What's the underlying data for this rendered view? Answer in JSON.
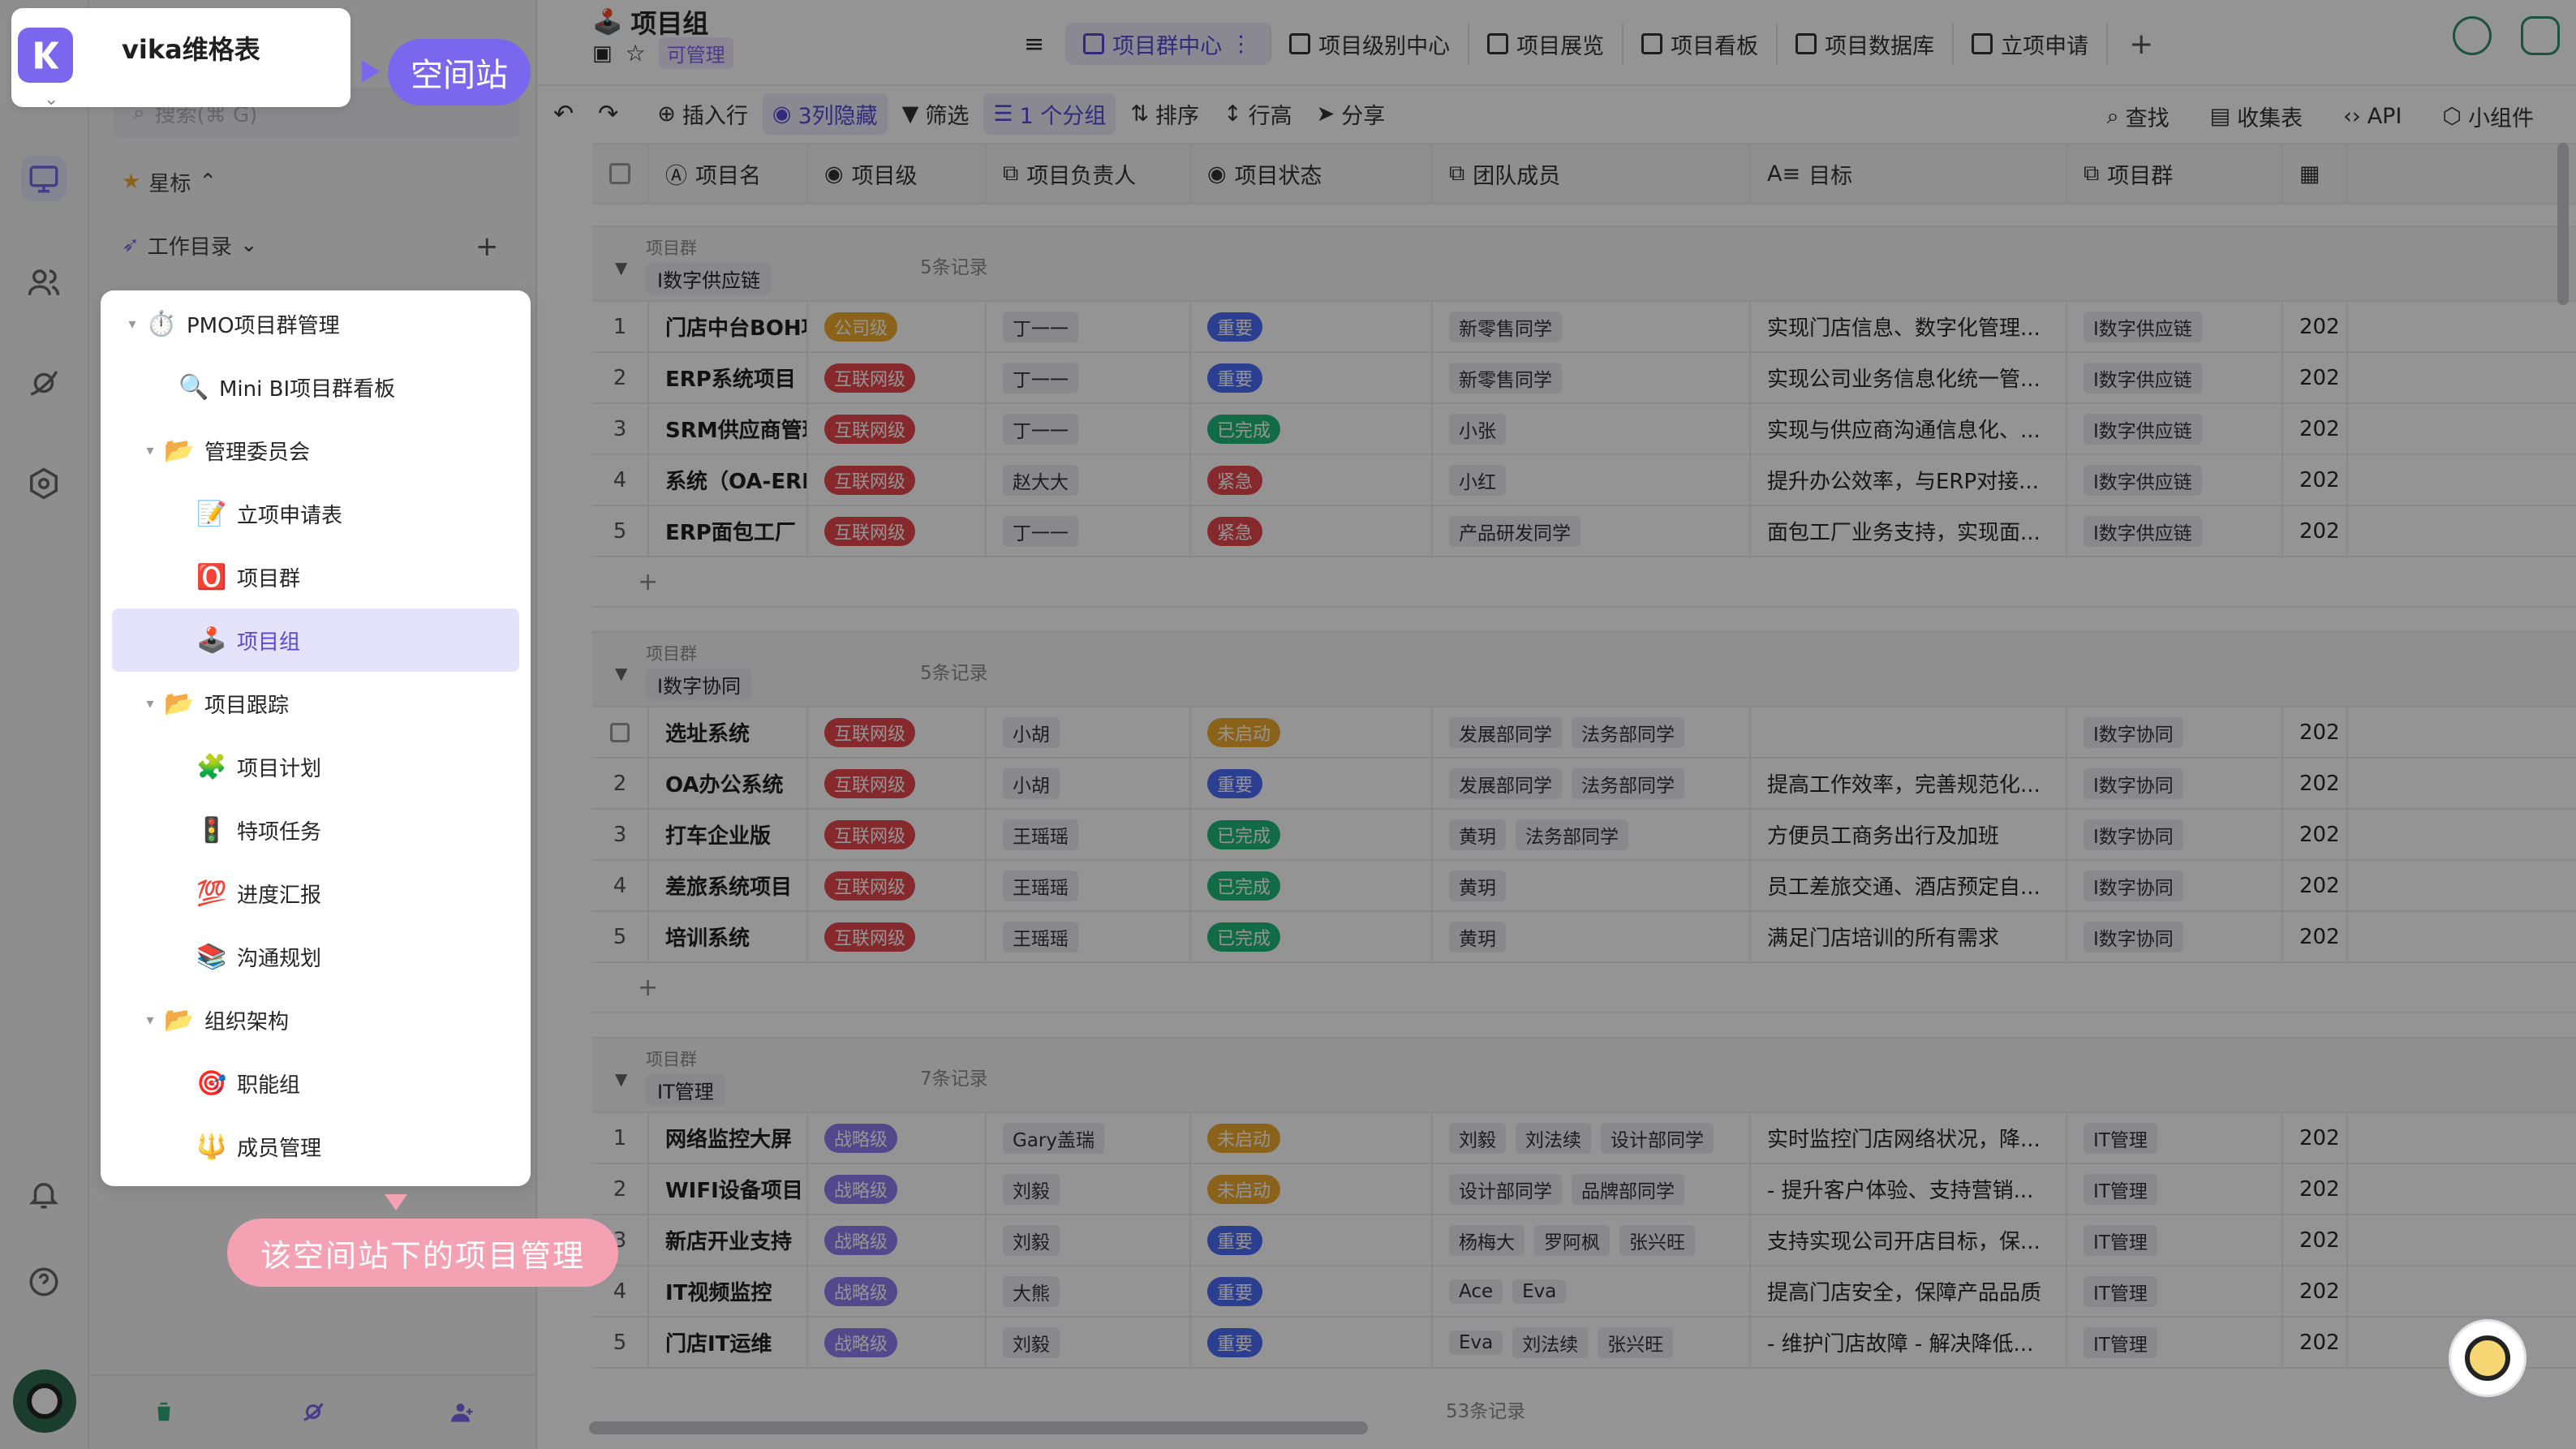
{
  "brand": {
    "name": "vika维格表"
  },
  "callouts": {
    "space": "空间站",
    "project": "该空间站下的项目管理"
  },
  "sidebar": {
    "search_placeholder": "搜索(⌘ G)",
    "starred": "星标",
    "catalog": "工作目录",
    "tree": [
      {
        "label": "PMO项目群管理",
        "level": 0,
        "caret": "▾",
        "icon": "⏱️",
        "icon_name": "stopwatch-icon"
      },
      {
        "label": "Mini BI项目群看板",
        "level": 1,
        "caret": "",
        "icon": "🔍",
        "icon_name": "magnifier-icon"
      },
      {
        "label": "管理委员会",
        "level": 1,
        "caret": "▾",
        "icon": "📂",
        "icon_name": "folder-icon"
      },
      {
        "label": "立项申请表",
        "level": 2,
        "caret": "",
        "icon": "📝",
        "icon_name": "memo-icon"
      },
      {
        "label": "项目群",
        "level": 2,
        "caret": "",
        "icon": "🅾️",
        "icon_name": "o-button-icon"
      },
      {
        "label": "项目组",
        "level": 2,
        "caret": "",
        "icon": "🕹️",
        "icon_name": "joystick-icon",
        "selected": true
      },
      {
        "label": "项目跟踪",
        "level": 1,
        "caret": "▾",
        "icon": "📂",
        "icon_name": "folder-icon"
      },
      {
        "label": "项目计划",
        "level": 2,
        "caret": "",
        "icon": "🧩",
        "icon_name": "puzzle-icon"
      },
      {
        "label": "特项任务",
        "level": 2,
        "caret": "",
        "icon": "🚦",
        "icon_name": "traffic-light-icon"
      },
      {
        "label": "进度汇报",
        "level": 2,
        "caret": "",
        "icon": "💯",
        "icon_name": "hundred-icon"
      },
      {
        "label": "沟通规划",
        "level": 2,
        "caret": "",
        "icon": "📚",
        "icon_name": "books-icon"
      },
      {
        "label": "组织架构",
        "level": 1,
        "caret": "▾",
        "icon": "📂",
        "icon_name": "folder-icon"
      },
      {
        "label": "职能组",
        "level": 2,
        "caret": "",
        "icon": "🎯",
        "icon_name": "target-icon"
      },
      {
        "label": "成员管理",
        "level": 2,
        "caret": "",
        "icon": "🔱",
        "icon_name": "trident-icon"
      }
    ]
  },
  "header": {
    "title": "项目组",
    "permission": "可管理",
    "tabs": [
      {
        "label": "项目群中心",
        "active": true
      },
      {
        "label": "项目级别中心"
      },
      {
        "label": "项目展览"
      },
      {
        "label": "项目看板"
      },
      {
        "label": "项目数据库"
      },
      {
        "label": "立项申请"
      }
    ]
  },
  "toolbar": {
    "insert": "插入行",
    "hidden": "3列隐藏",
    "filter": "筛选",
    "group": "1 个分组",
    "sort": "排序",
    "row_height": "行高",
    "share": "分享",
    "find": "查找",
    "form": "收集表",
    "api": "API",
    "widget": "小组件"
  },
  "columns": [
    "项目名",
    "项目级",
    "项目负责人",
    "项目状态",
    "团队成员",
    "目标",
    "项目群"
  ],
  "colors": {
    "accent": "#7b67ee",
    "level": {
      "公司级": "#f0a92e",
      "互联网级": "#e5484d",
      "战略级": "#8e7cf0"
    },
    "status": {
      "重要": "#4a6cf7",
      "已完成": "#1fb87a",
      "紧急": "#e5484d",
      "未启动": "#f0a92e"
    }
  },
  "groups": [
    {
      "label": "项目群",
      "value": "I数字供应链",
      "count": "5条记录",
      "rows": [
        {
          "idx": "1",
          "name": "门店中台BOH项目",
          "level": "公司级",
          "owner": "丁一一",
          "status": "重要",
          "members": [
            "新零售同学"
          ],
          "goal": "实现门店信息、数字化管理...",
          "group": "I数字供应链",
          "date": "202"
        },
        {
          "idx": "2",
          "name": "ERP系统项目",
          "level": "互联网级",
          "owner": "丁一一",
          "status": "重要",
          "members": [
            "新零售同学"
          ],
          "goal": "实现公司业务信息化统一管...",
          "group": "I数字供应链",
          "date": "202"
        },
        {
          "idx": "3",
          "name": "SRM供应商管理系统项目",
          "level": "互联网级",
          "owner": "丁一一",
          "status": "已完成",
          "members": [
            "小张"
          ],
          "goal": "实现与供应商沟通信息化、...",
          "group": "I数字供应链",
          "date": "202"
        },
        {
          "idx": "4",
          "name": "系统（OA-ERP-银行）",
          "level": "互联网级",
          "owner": "赵大大",
          "status": "紧急",
          "members": [
            "小红"
          ],
          "goal": "提升办公效率，与ERP对接...",
          "group": "I数字供应链",
          "date": "202"
        },
        {
          "idx": "5",
          "name": "ERP面包工厂",
          "level": "互联网级",
          "owner": "丁一一",
          "status": "紧急",
          "members": [
            "产品研发同学"
          ],
          "goal": "面包工厂业务支持，实现面...",
          "group": "I数字供应链",
          "date": "202"
        }
      ]
    },
    {
      "label": "项目群",
      "value": "I数字协同",
      "count": "5条记录",
      "rows": [
        {
          "idx": "",
          "name": "选址系统",
          "level": "互联网级",
          "owner": "小胡",
          "status": "未启动",
          "members": [
            "发展部同学",
            "法务部同学"
          ],
          "goal": "",
          "group": "I数字协同",
          "date": "202"
        },
        {
          "idx": "2",
          "name": "OA办公系统",
          "level": "互联网级",
          "owner": "小胡",
          "status": "重要",
          "members": [
            "发展部同学",
            "法务部同学"
          ],
          "goal": "提高工作效率，完善规范化...",
          "group": "I数字协同",
          "date": "202"
        },
        {
          "idx": "3",
          "name": "打车企业版",
          "level": "互联网级",
          "owner": "王瑶瑶",
          "status": "已完成",
          "members": [
            "黄玥",
            "法务部同学"
          ],
          "goal": "方便员工商务出行及加班",
          "group": "I数字协同",
          "date": "202"
        },
        {
          "idx": "4",
          "name": "差旅系统项目",
          "level": "互联网级",
          "owner": "王瑶瑶",
          "status": "已完成",
          "members": [
            "黄玥"
          ],
          "goal": "员工差旅交通、酒店预定自...",
          "group": "I数字协同",
          "date": "202"
        },
        {
          "idx": "5",
          "name": "培训系统",
          "level": "互联网级",
          "owner": "王瑶瑶",
          "status": "已完成",
          "members": [
            "黄玥"
          ],
          "goal": "满足门店培训的所有需求",
          "group": "I数字协同",
          "date": "202"
        }
      ]
    },
    {
      "label": "项目群",
      "value": "IT管理",
      "count": "7条记录",
      "rows": [
        {
          "idx": "1",
          "name": "网络监控大屏",
          "level": "战略级",
          "owner": "Gary盖瑞",
          "status": "未启动",
          "members": [
            "刘毅",
            "刘法续",
            "设计部同学"
          ],
          "goal": "实时监控门店网络状况，降...",
          "group": "IT管理",
          "date": "202"
        },
        {
          "idx": "2",
          "name": "WIFI设备项目",
          "level": "战略级",
          "owner": "刘毅",
          "status": "未启动",
          "members": [
            "设计部同学",
            "品牌部同学"
          ],
          "goal": "- 提升客户体验、支持营销...",
          "group": "IT管理",
          "date": "202"
        },
        {
          "idx": "3",
          "name": "新店开业支持",
          "level": "战略级",
          "owner": "刘毅",
          "status": "重要",
          "members": [
            "杨梅大",
            "罗阿枫",
            "张兴旺"
          ],
          "goal": "支持实现公司开店目标，保...",
          "group": "IT管理",
          "date": "202"
        },
        {
          "idx": "4",
          "name": "IT视频监控",
          "level": "战略级",
          "owner": "大熊",
          "status": "重要",
          "members": [
            "Ace",
            "Eva"
          ],
          "goal": "提高门店安全，保障产品品质",
          "group": "IT管理",
          "date": "202"
        },
        {
          "idx": "5",
          "name": "门店IT运维",
          "level": "战略级",
          "owner": "刘毅",
          "status": "重要",
          "members": [
            "Eva",
            "刘法续",
            "张兴旺"
          ],
          "goal": "- 维护门店故障 - 解决降低...",
          "group": "IT管理",
          "date": "202"
        }
      ]
    }
  ],
  "footer": {
    "total": "53条记录"
  }
}
